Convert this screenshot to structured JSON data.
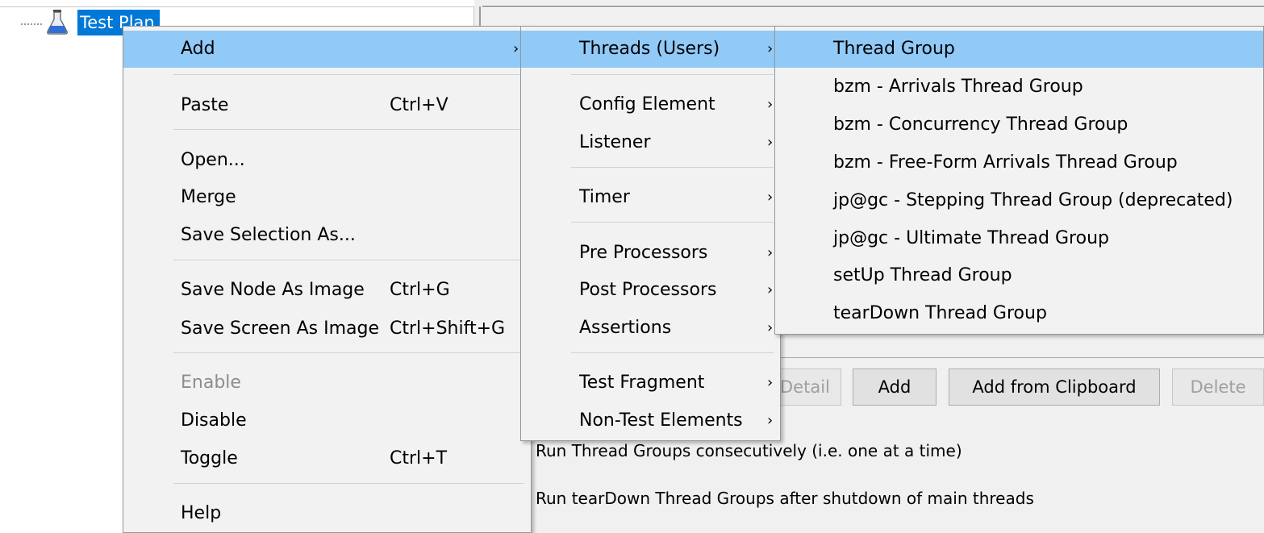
{
  "tree": {
    "root_label": "Test Plan",
    "root_icon": "flask-icon"
  },
  "context_menu": {
    "items": [
      {
        "label": "Add",
        "shortcut": "",
        "has_submenu": true
      },
      {
        "label": "Paste",
        "shortcut": "Ctrl+V"
      },
      {
        "label": "Open...",
        "shortcut": ""
      },
      {
        "label": "Merge",
        "shortcut": ""
      },
      {
        "label": "Save Selection As...",
        "shortcut": ""
      },
      {
        "label": "Save Node As Image",
        "shortcut": "Ctrl+G"
      },
      {
        "label": "Save Screen As Image",
        "shortcut": "Ctrl+Shift+G"
      },
      {
        "label": "Enable",
        "shortcut": "",
        "disabled": true
      },
      {
        "label": "Disable",
        "shortcut": ""
      },
      {
        "label": "Toggle",
        "shortcut": "Ctrl+T"
      },
      {
        "label": "Help",
        "shortcut": ""
      }
    ]
  },
  "add_submenu": {
    "items": [
      {
        "label": "Threads (Users)"
      },
      {
        "label": "Config Element"
      },
      {
        "label": "Listener"
      },
      {
        "label": "Timer"
      },
      {
        "label": "Pre Processors"
      },
      {
        "label": "Post Processors"
      },
      {
        "label": "Assertions"
      },
      {
        "label": "Test Fragment"
      },
      {
        "label": "Non-Test Elements"
      }
    ]
  },
  "threads_submenu": {
    "items": [
      {
        "label": "Thread Group"
      },
      {
        "label": "bzm - Arrivals Thread Group"
      },
      {
        "label": "bzm - Concurrency Thread Group"
      },
      {
        "label": "bzm - Free-Form Arrivals Thread Group"
      },
      {
        "label": "jp@gc - Stepping Thread Group (deprecated)"
      },
      {
        "label": "jp@gc - Ultimate Thread Group"
      },
      {
        "label": "setUp Thread Group"
      },
      {
        "label": "tearDown Thread Group"
      }
    ]
  },
  "buttons": {
    "detail": "Detail",
    "add": "Add",
    "add_from_clipboard": "Add from Clipboard",
    "delete": "Delete"
  },
  "options": {
    "consecutive": "Run Thread Groups consecutively (i.e. one at a time)",
    "teardown": "Run tearDown Thread Groups after shutdown of main threads"
  },
  "symbols": {
    "submenu_arrow": "›"
  },
  "colors": {
    "selection": "#0078d7",
    "menu_highlight": "#91c9f7",
    "menu_background": "#f2f2f2"
  }
}
